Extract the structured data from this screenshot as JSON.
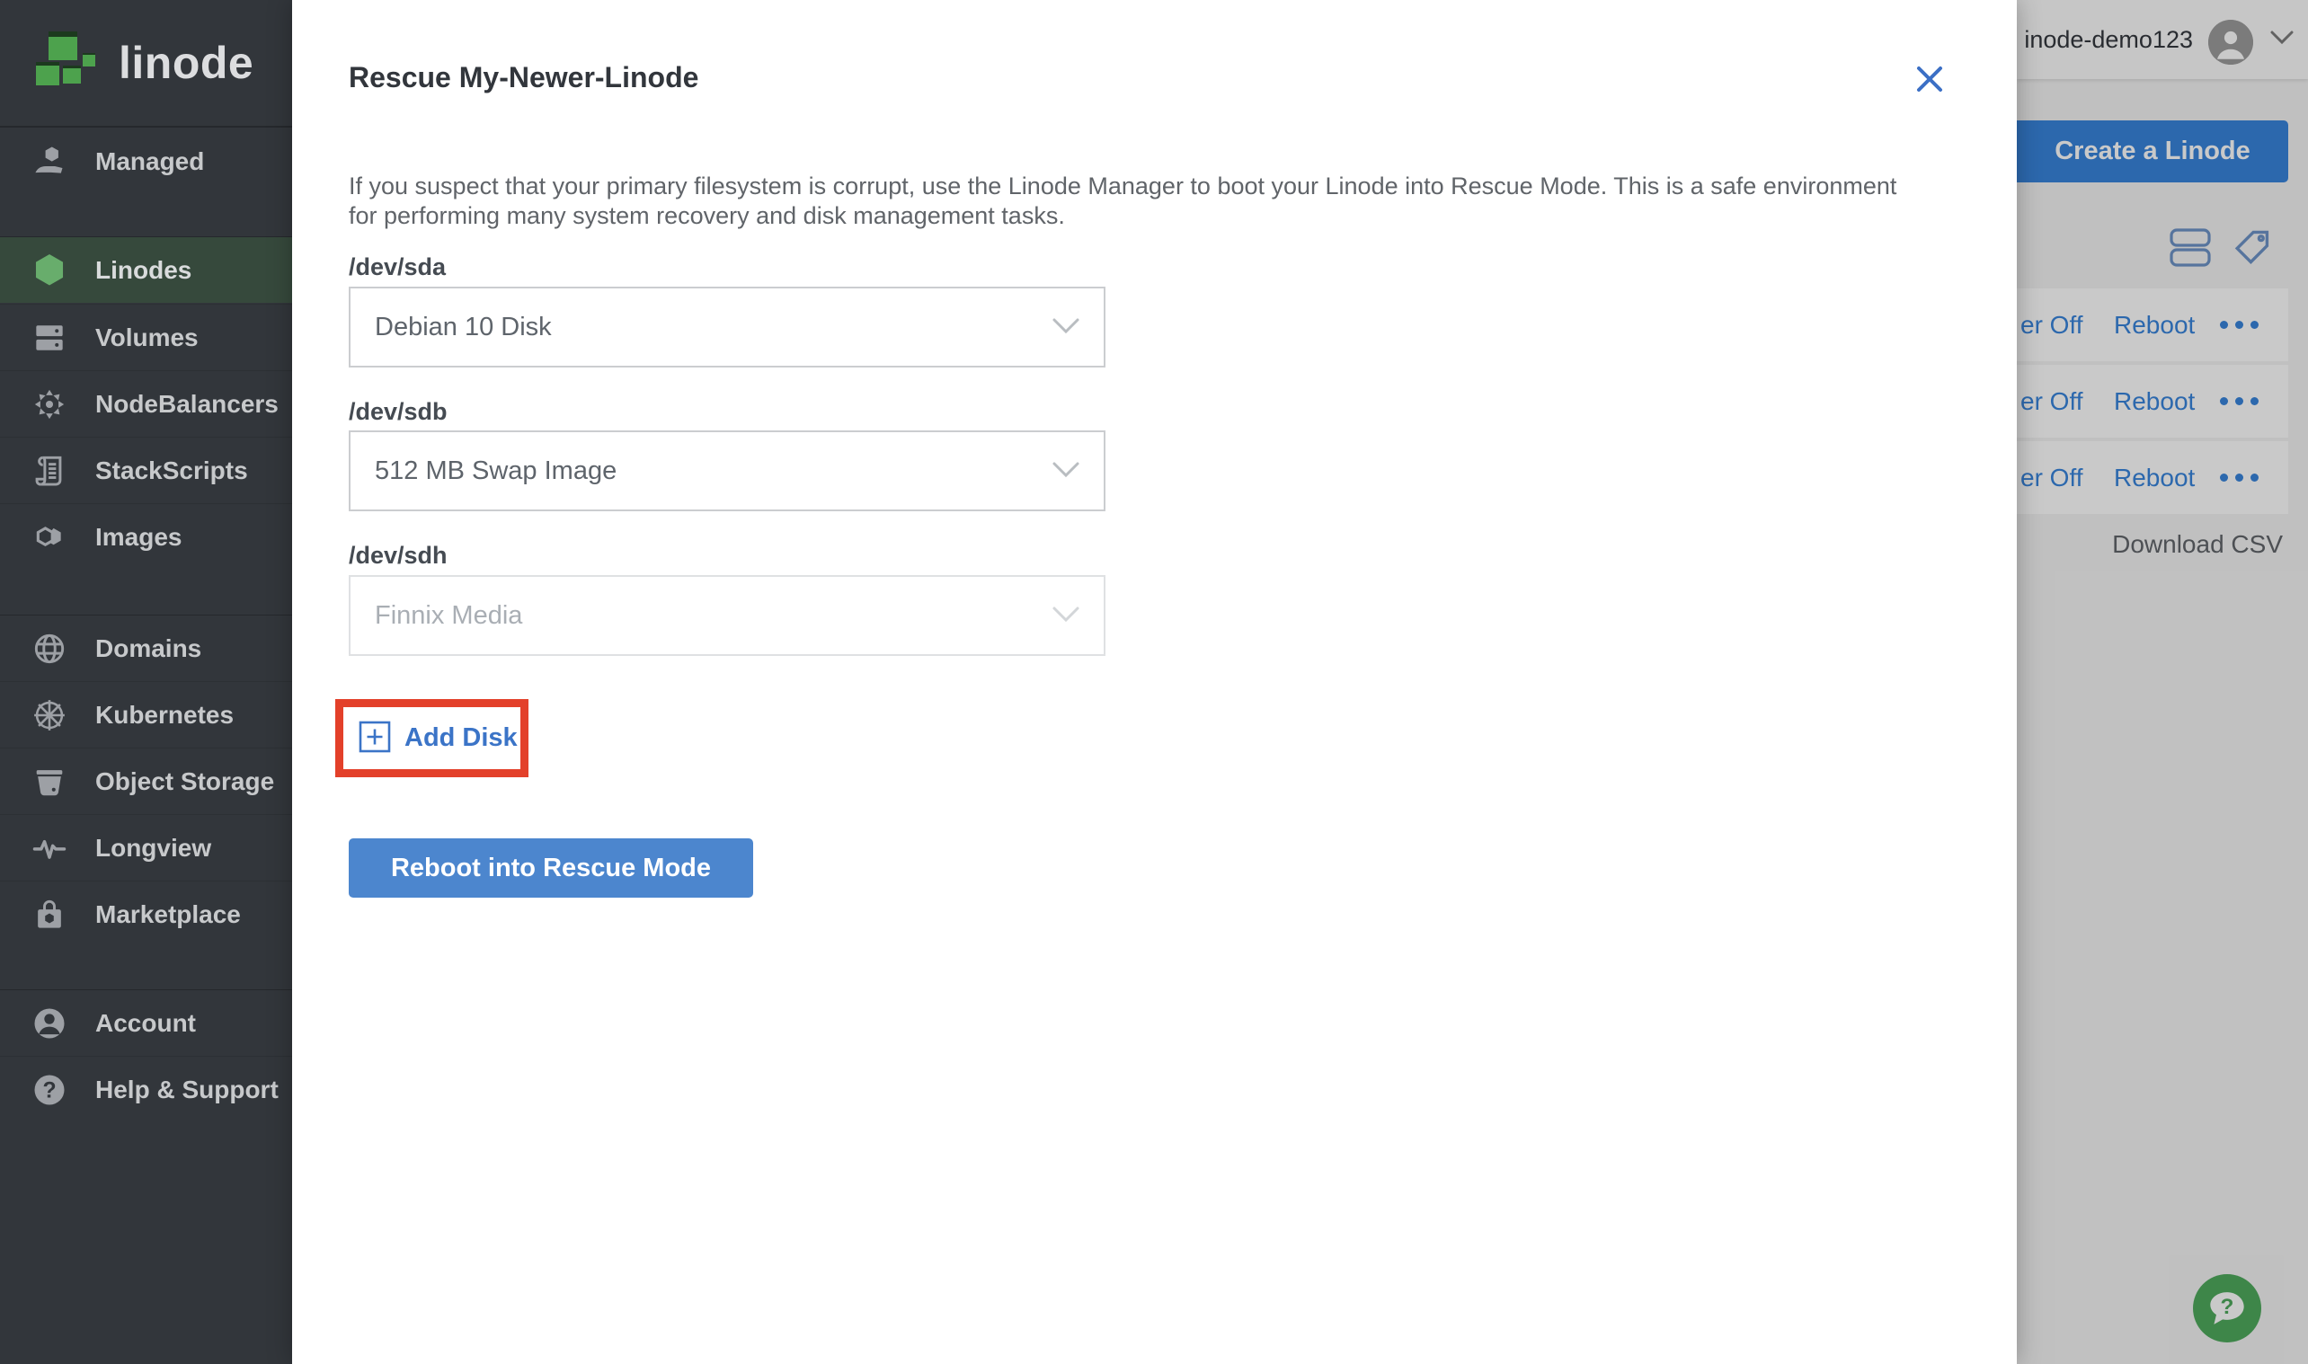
{
  "sidebar": {
    "logo_text": "linode",
    "items": [
      {
        "label": "Managed",
        "icon": "managed-icon"
      },
      {
        "label": "Linodes",
        "icon": "linodes-icon",
        "active": true
      },
      {
        "label": "Volumes",
        "icon": "volumes-icon"
      },
      {
        "label": "NodeBalancers",
        "icon": "nodebalancers-icon"
      },
      {
        "label": "StackScripts",
        "icon": "stackscripts-icon"
      },
      {
        "label": "Images",
        "icon": "images-icon"
      },
      {
        "label": "Domains",
        "icon": "domains-icon"
      },
      {
        "label": "Kubernetes",
        "icon": "kubernetes-icon"
      },
      {
        "label": "Object Storage",
        "icon": "object-storage-icon"
      },
      {
        "label": "Longview",
        "icon": "longview-icon"
      },
      {
        "label": "Marketplace",
        "icon": "marketplace-icon"
      },
      {
        "label": "Account",
        "icon": "account-icon"
      },
      {
        "label": "Help & Support",
        "icon": "help-icon"
      }
    ]
  },
  "modal": {
    "title": "Rescue My-Newer-Linode",
    "description_lines": [
      "If you suspect that your primary filesystem is corrupt, use the Linode Manager to boot your Linode into Rescue Mode. This is a safe environment",
      "for performing many system recovery and disk management tasks."
    ],
    "fields": [
      {
        "label": "/dev/sda",
        "value": "Debian 10 Disk",
        "disabled": false
      },
      {
        "label": "/dev/sdb",
        "value": "512 MB Swap Image",
        "disabled": false
      },
      {
        "label": "/dev/sdh",
        "value": "Finnix Media",
        "disabled": true
      }
    ],
    "add_disk_label": "Add Disk",
    "submit_label": "Reboot into Rescue Mode"
  },
  "background": {
    "topbar": {
      "username": "inode-demo123"
    },
    "create_button_label": "Create a Linode",
    "rows": [
      {
        "power_label": "er Off",
        "reboot_label": "Reboot"
      },
      {
        "power_label": "er Off",
        "reboot_label": "Reboot"
      },
      {
        "power_label": "er Off",
        "reboot_label": "Reboot"
      }
    ],
    "download_csv_label": "Download CSV"
  },
  "icons": {
    "close": "x-cross",
    "chevron_down": "v-chevron",
    "row_actions": "ellipsis-three-dots",
    "add_disk": "plus-square",
    "view_toggles": [
      "summary-view-icon",
      "group-by-tag-icon"
    ],
    "help_fab": "question-speech-bubble"
  },
  "colors": {
    "sidebar_bg": "#32363b",
    "sidebar_active_bg": "#36493c",
    "logo_green": "#4da24d",
    "active_hexagon_green": "#68ad6c",
    "primary_blue": "#3683dc",
    "modal_link_blue": "#3b74c7",
    "submit_button_blue": "#4c86ce",
    "annotation_red": "#e3402a",
    "title_gray": "#32363c",
    "body_gray": "#606469",
    "help_fab_green": "#4da95c"
  }
}
